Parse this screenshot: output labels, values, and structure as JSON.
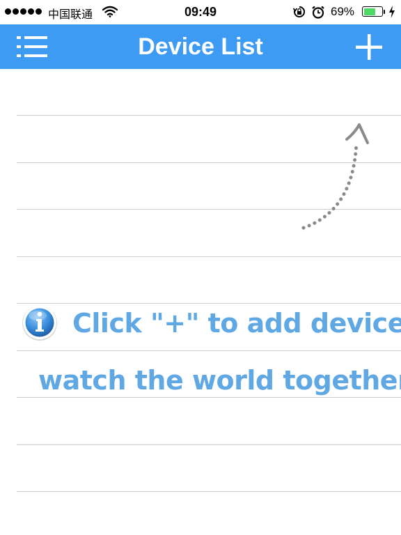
{
  "status_bar": {
    "carrier": "中国联通",
    "time": "09:49",
    "battery_percent_label": "69%",
    "battery_level": 0.69,
    "icons": [
      "signal-dots-icon",
      "wifi-icon",
      "rotation-lock-icon",
      "alarm-icon",
      "battery-icon",
      "charging-icon"
    ]
  },
  "nav": {
    "title": "Device List",
    "left_icon": "menu-icon",
    "right_icon": "plus-icon"
  },
  "hint": {
    "icon": "info-icon",
    "line1": "Click \"+\" to add device",
    "line2": "watch the world together",
    "arrow_icon": "dotted-arrow-icon"
  },
  "colors": {
    "nav_background": "#3d9bf3",
    "hint_text": "#5fa8e4",
    "rule_lines": "#cfcfcf",
    "battery_fill": "#4cd964"
  }
}
